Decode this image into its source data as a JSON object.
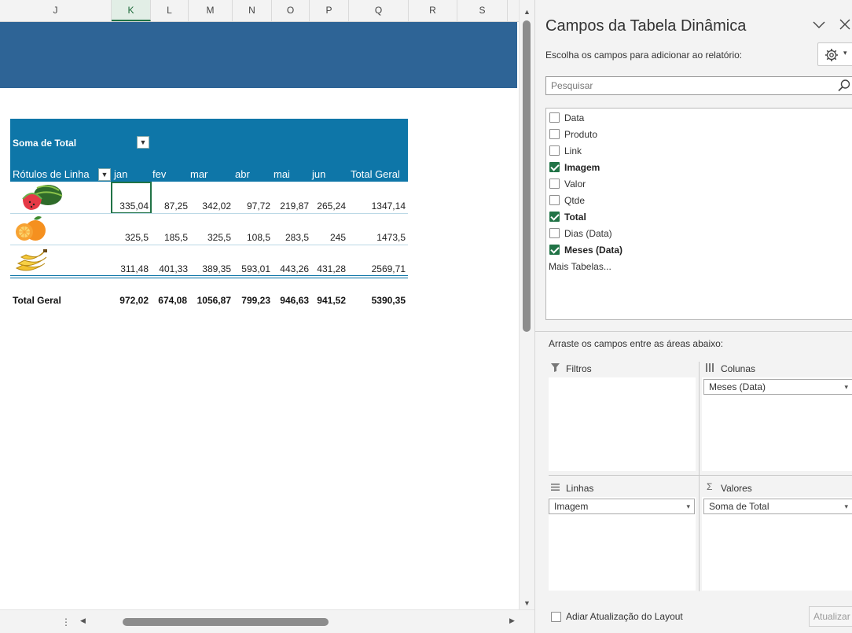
{
  "sheet": {
    "columns": [
      {
        "label": "J",
        "active": false
      },
      {
        "label": "K",
        "active": true
      },
      {
        "label": "L",
        "active": false
      },
      {
        "label": "M",
        "active": false
      },
      {
        "label": "N",
        "active": false
      },
      {
        "label": "O",
        "active": false
      },
      {
        "label": "P",
        "active": false
      },
      {
        "label": "Q",
        "active": false
      },
      {
        "label": "R",
        "active": false
      },
      {
        "label": "S",
        "active": false
      }
    ],
    "colors": {
      "banner": "#2e6496",
      "pivot_header": "#0e76a8",
      "active_cell": "#217346"
    }
  },
  "pivot": {
    "value_field": "Soma de Total",
    "row_labels": "Rótulos de Linha",
    "months": [
      "jan",
      "fev",
      "mar",
      "abr",
      "mai",
      "jun"
    ],
    "grand_total_header": "Total Geral",
    "rows": [
      {
        "icon": "watermelon-icon",
        "values": [
          "335,04",
          "87,25",
          "342,02",
          "97,72",
          "219,87",
          "265,24"
        ],
        "total": "1347,14"
      },
      {
        "icon": "orange-icon",
        "values": [
          "325,5",
          "185,5",
          "325,5",
          "108,5",
          "283,5",
          "245"
        ],
        "total": "1473,5"
      },
      {
        "icon": "banana-icon",
        "values": [
          "311,48",
          "401,33",
          "389,35",
          "593,01",
          "443,26",
          "431,28"
        ],
        "total": "2569,71"
      }
    ],
    "grand_total": {
      "label": "Total Geral",
      "values": [
        "972,02",
        "674,08",
        "1056,87",
        "799,23",
        "946,63",
        "941,52"
      ],
      "total": "5390,35"
    }
  },
  "panel": {
    "title": "Campos da Tabela Dinâmica",
    "subtitle": "Escolha os campos para adicionar ao relatório:",
    "search_placeholder": "Pesquisar",
    "fields": [
      {
        "label": "Data",
        "checked": false
      },
      {
        "label": "Produto",
        "checked": false
      },
      {
        "label": "Link",
        "checked": false
      },
      {
        "label": "Imagem",
        "checked": true
      },
      {
        "label": "Valor",
        "checked": false
      },
      {
        "label": "Qtde",
        "checked": false
      },
      {
        "label": "Total",
        "checked": true
      },
      {
        "label": "Dias (Data)",
        "checked": false
      },
      {
        "label": "Meses (Data)",
        "checked": true
      }
    ],
    "more_tables": "Mais Tabelas...",
    "drag_hint": "Arraste os campos entre as áreas abaixo:",
    "areas": {
      "filters": {
        "label": "Filtros",
        "items": []
      },
      "columns": {
        "label": "Colunas",
        "items": [
          "Meses (Data)"
        ]
      },
      "rows": {
        "label": "Linhas",
        "items": [
          "Imagem"
        ]
      },
      "values": {
        "label": "Valores",
        "items": [
          "Soma de Total"
        ]
      }
    },
    "defer_label": "Adiar Atualização do Layout",
    "update_button": "Atualizar"
  }
}
